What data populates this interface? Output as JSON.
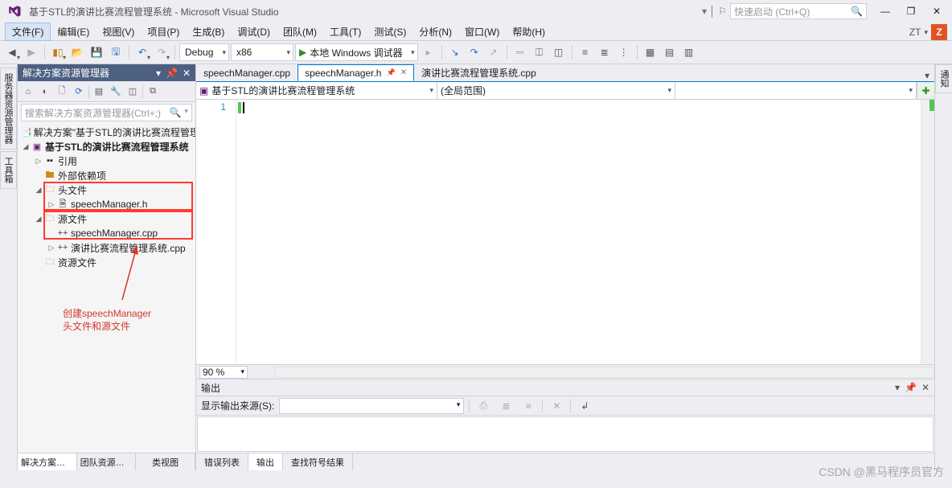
{
  "title": "基于STL的演讲比赛流程管理系统 - Microsoft Visual Studio",
  "quick_launch_placeholder": "快速启动 (Ctrl+Q)",
  "user_initials": "ZT",
  "user_badge": "Z",
  "menu": [
    "文件(F)",
    "编辑(E)",
    "视图(V)",
    "项目(P)",
    "生成(B)",
    "调试(D)",
    "团队(M)",
    "工具(T)",
    "测试(S)",
    "分析(N)",
    "窗口(W)",
    "帮助(H)"
  ],
  "toolbar": {
    "config": "Debug",
    "platform": "x86",
    "start": "本地 Windows 调试器"
  },
  "left_vtabs": [
    "服务器资源管理器",
    "工具箱"
  ],
  "right_vtabs": [
    "通知"
  ],
  "explorer": {
    "title": "解决方案资源管理器",
    "search_placeholder": "搜索解决方案资源管理器(Ctrl+;)",
    "solution": "解决方案\"基于STL的演讲比赛流程管理系统\"",
    "project": "基于STL的演讲比赛流程管理系统",
    "refs": "引用",
    "ext_deps": "外部依赖项",
    "headers": "头文件",
    "header_file": "speechManager.h",
    "sources": "源文件",
    "src1": "speechManager.cpp",
    "src2": "演讲比赛流程管理系统.cpp",
    "resources": "资源文件",
    "tabs": [
      "解决方案资源管...",
      "团队资源管理器",
      "类视图"
    ]
  },
  "annotation": {
    "line1": "创建speechManager",
    "line2": "头文件和源文件"
  },
  "doc_tabs": [
    {
      "label": "speechManager.cpp",
      "active": false
    },
    {
      "label": "speechManager.h",
      "active": true
    },
    {
      "label": "演讲比赛流程管理系统.cpp",
      "active": false
    }
  ],
  "nav": {
    "scope1": "基于STL的演讲比赛流程管理系统",
    "scope2": "(全局范围)"
  },
  "line_number": "1",
  "zoom": "90 %",
  "output": {
    "title": "输出",
    "source_label": "显示输出来源(S):"
  },
  "bottom_tabs": [
    "错误列表",
    "输出",
    "查找符号结果"
  ],
  "watermark": "CSDN @黑马程序员官方"
}
